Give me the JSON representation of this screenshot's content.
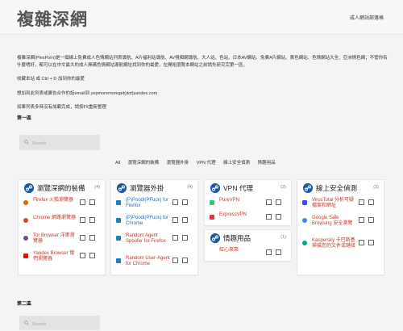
{
  "header": {
    "logo": "複雜深網",
    "site_link": "成人網站部落格"
  },
  "intro": {
    "p1": "複雜深網(PlexPorn)是一個線上免費成人色情網站列表導航、A片福利站導航、AV視頻網導航、大人站、色站、日本AV網站、免費A片網站、黃色網站、色情網站大全、亞洲情色網；不管你有什麼嗜好，都可以在中文最大的成人無碼色情網站導航網址找到你的最愛，在開始瀏覽本網站之前請先研究完第一區。",
    "p2": "收藏本站 或 Ctrl + D 加到你的最愛",
    "p3": "想加到此列表或廣告合作的話email到 yepmoremoreget(dot)yandex.com",
    "p4": "如果列表多時沒有加載完成，請按F5重新整理"
  },
  "section1": {
    "title": "第一區",
    "search_placeholder": "Search"
  },
  "section2": {
    "title": "第二區",
    "search_placeholder": "Search"
  },
  "filters": [
    "All",
    "瀏覽深網的裝備",
    "瀏覽器外掛",
    "VPN 代理",
    "線上安全偵測",
    "情趣用品"
  ],
  "cards": [
    {
      "title": "瀏覽深網的裝備",
      "count": "(4)",
      "items": [
        {
          "name": "Firefox 火狐瀏覽器",
          "icon": "firefox-icon",
          "color": "#e66000"
        },
        {
          "name": "Chrome 網路瀏覽器",
          "icon": "chrome-icon",
          "color": "#db4437"
        },
        {
          "name": "Tor Browser 洋蔥瀏覽器",
          "icon": "tor-icon",
          "color": "#7d4698"
        },
        {
          "name": "Yandex Browser 俄們瀏覽器",
          "icon": "yandex-icon",
          "color": "#ff0000"
        }
      ]
    },
    {
      "title": "瀏覽器外掛",
      "count": "(4)",
      "items": [
        {
          "name": "(P)Poodl(PFuck) for Firefox",
          "icon": "extension-icon",
          "color": "#1a7fc1"
        },
        {
          "name": "(P)Poodl(PFuck) for Chrome",
          "icon": "extension-icon",
          "color": "#1a7fc1"
        },
        {
          "name": "Random Agent Spoofer for Firefox",
          "icon": "extension-icon",
          "color": "#1a7fc1"
        },
        {
          "name": "Random User-Agent for Chrome",
          "icon": "extension-icon",
          "color": "#1a7fc1"
        }
      ]
    },
    {
      "title": "VPN 代理",
      "count": "(2)",
      "items": [
        {
          "name": "PureVPN",
          "icon": "purevpn-icon",
          "color": "#2ecc71"
        },
        {
          "name": "ExpressVPN",
          "icon": "expressvpn-icon",
          "color": "#da3940"
        }
      ]
    },
    {
      "title": "線上安全偵測",
      "count": "(3)",
      "items": [
        {
          "name": "VirusTotal 分析可疑檔案和網址",
          "icon": "virustotal-icon",
          "color": "#394eff"
        },
        {
          "name": "Google Safe Browsing 安全瀏覽",
          "icon": "google-icon",
          "color": "#4285f4"
        },
        {
          "name": "Kaspersky 卡巴斯基 掃描您的文件或鏈接",
          "icon": "kaspersky-icon",
          "color": "#00a88e"
        }
      ]
    },
    {
      "title": "情趣用品",
      "count": "(1)",
      "items": [
        {
          "name": "紅心來來",
          "icon": "shop-icon",
          "color": "#e74c3c"
        }
      ]
    }
  ]
}
